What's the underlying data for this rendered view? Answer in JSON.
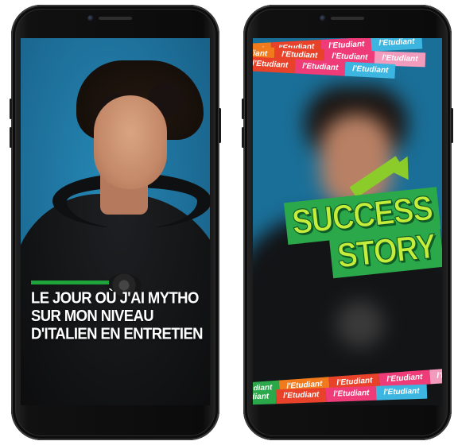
{
  "left_phone": {
    "title_lines": [
      "LE JOUR OÙ J'AI MYTHO",
      "SUR MON NIVEAU",
      "D'ITALIEN EN ENTRETIEN"
    ],
    "accent_color": "#1fa43c"
  },
  "right_phone": {
    "badge_line1": "SUCCESS",
    "badge_line2": "STORY",
    "brand_tag": "l'Etudiant",
    "tag_colors": [
      "#e8432a",
      "#ef3b78",
      "#f07a1c",
      "#2ba84a",
      "#3cb6e0",
      "#f39bbd"
    ],
    "badge_colors": {
      "box": "#2aa84a",
      "text": "#c4ec3a",
      "arrow": "#8ccc2a"
    }
  }
}
